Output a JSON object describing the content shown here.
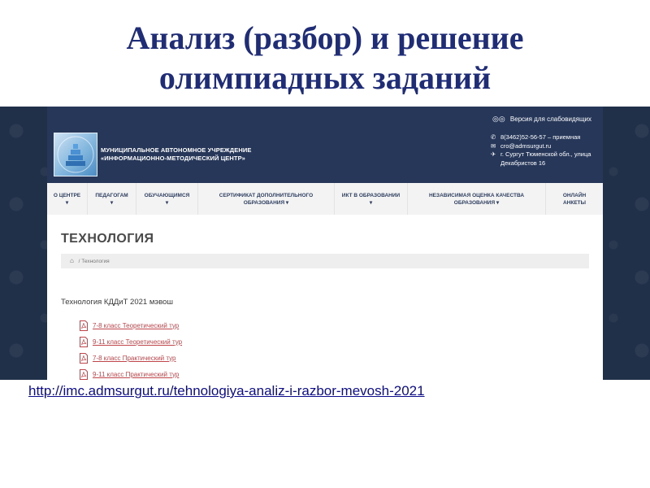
{
  "slide": {
    "title_line1": "Анализ (разбор) и решение",
    "title_line2": "олимпиадных заданий",
    "url": "http://imc.admsurgut.ru/tehnologiya-analiz-i-razbor-mevosh-2021"
  },
  "header": {
    "accessibility_label": "Версия для слабовидящих",
    "org_line1": "МУНИЦИПАЛЬНОЕ АВТОНОМНОЕ УЧРЕЖДЕНИЕ",
    "org_line2": "«ИНФОРМАЦИОННО-МЕТОДИЧЕСКИЙ ЦЕНТР»",
    "phone": "8(3462)52-56-57 – приемная",
    "email": "cro@admsurgut.ru",
    "address_line1": "г. Сургут Тюменской обл., улица",
    "address_line2": "Декабристов 16"
  },
  "menu": {
    "items": [
      {
        "line1": "О ЦЕНТРЕ",
        "line2": "▾"
      },
      {
        "line1": "ПЕДАГОГАМ",
        "line2": "▾"
      },
      {
        "line1": "ОБУЧАЮЩИМСЯ",
        "line2": "▾"
      },
      {
        "line1": "СЕРТИФИКАТ ДОПОЛНИТЕЛЬНОГО",
        "line2": "ОБРАЗОВАНИЯ ▾"
      },
      {
        "line1": "ИКТ В ОБРАЗОВАНИИ",
        "line2": "▾"
      },
      {
        "line1": "НЕЗАВИСИМАЯ ОЦЕНКА КАЧЕСТВА",
        "line2": "ОБРАЗОВАНИЯ ▾"
      },
      {
        "line1": "ОНЛАЙН",
        "line2": "АНКЕТЫ"
      }
    ]
  },
  "content": {
    "page_heading": "ТЕХНОЛОГИЯ",
    "breadcrumb_current": "/ Технология",
    "section_title": "Технология КДДиТ 2021 мэвош",
    "files": [
      {
        "label": "7-8 класс Теоретический тур"
      },
      {
        "label": "9-11 класс Теоретический тур"
      },
      {
        "label": "7-8 класс Практический тур"
      },
      {
        "label": "9-11 класс Практический тур"
      }
    ]
  },
  "icons": {
    "accessibility": "glasses-icon",
    "phone": "phone-icon",
    "email": "envelope-icon",
    "address": "location-pin-icon",
    "breadcrumb_home": "home-icon",
    "file": "pdf-icon"
  },
  "colors": {
    "slide_title": "#1f2d78",
    "header_bg": "#26375a",
    "outer_bg": "#213049",
    "menu_text": "#2e3f60",
    "link": "#c0454a",
    "url": "#0d0d8c"
  }
}
